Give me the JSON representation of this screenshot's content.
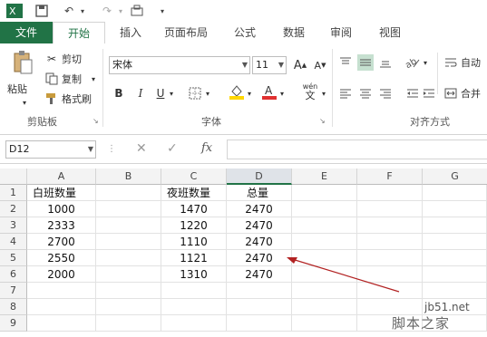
{
  "tabs": [
    "文件",
    "开始",
    "插入",
    "页面布局",
    "公式",
    "数据",
    "审阅",
    "视图"
  ],
  "clipboard": {
    "paste": "粘贴",
    "cut": "剪切",
    "copy": "复制",
    "format_painter": "格式刷",
    "label": "剪贴板"
  },
  "font_group": {
    "font_name": "宋体",
    "font_size": "11",
    "label": "字体",
    "phonetic": "wén"
  },
  "align_group": {
    "label": "对齐方式",
    "wrap": "自动",
    "merge": "合并"
  },
  "formula_bar": {
    "name_box": "D12",
    "fx": "fx",
    "formula": ""
  },
  "columns": [
    "A",
    "B",
    "C",
    "D",
    "E",
    "F",
    "G"
  ],
  "rows": [
    "1",
    "2",
    "3",
    "4",
    "5",
    "6",
    "7",
    "8",
    "9"
  ],
  "sheet": {
    "headers": {
      "A": "白班数量",
      "C": "夜班数量",
      "D": "总量"
    },
    "data": [
      {
        "A": "1000",
        "C": "1470",
        "D": "2470"
      },
      {
        "A": "2333",
        "C": "1220",
        "D": "2470"
      },
      {
        "A": "2700",
        "C": "1110",
        "D": "2470"
      },
      {
        "A": "2550",
        "C": "1121",
        "D": "2470"
      },
      {
        "A": "2000",
        "C": "1310",
        "D": "2470"
      }
    ]
  },
  "watermark": {
    "line1": "jb51.net",
    "line2": "脚本之家"
  },
  "colors": {
    "accent": "#217346",
    "arrow": "#b22222"
  }
}
